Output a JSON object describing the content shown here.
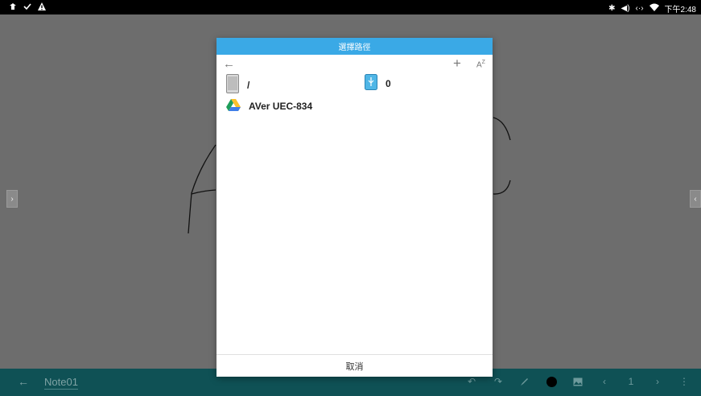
{
  "status_bar": {
    "time": "下午2:48",
    "left_icons": [
      "usb-debug-icon",
      "check-icon",
      "warning-icon"
    ],
    "right_icons": [
      "bluetooth-icon",
      "volume-icon",
      "ethernet-icon",
      "wifi-icon"
    ]
  },
  "dialog": {
    "title": "選擇路徑",
    "entries": [
      {
        "icon": "tablet-device-icon",
        "label": "/"
      },
      {
        "icon": "usb-storage-icon",
        "label": "0"
      },
      {
        "icon": "google-drive-icon",
        "label": "AVer UEC-834"
      }
    ],
    "cancel_label": "取消"
  },
  "bottom_bar": {
    "note_title": "Note01",
    "page_number": "1"
  },
  "colors": {
    "dialog_header": "#3aa9e6",
    "bottom_bar": "#0f5155",
    "canvas_dim": "#6d6d6d"
  }
}
